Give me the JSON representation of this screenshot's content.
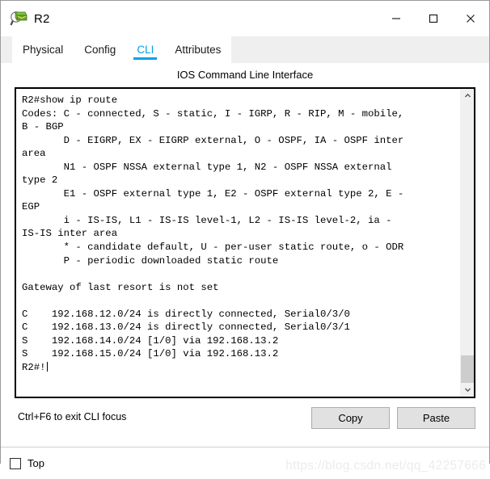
{
  "window": {
    "title": "R2",
    "icon": "router-device-icon",
    "controls": {
      "minimize": "minimize-icon",
      "maximize": "maximize-icon",
      "close": "close-icon"
    }
  },
  "tabs": [
    {
      "label": "Physical",
      "active": false
    },
    {
      "label": "Config",
      "active": false
    },
    {
      "label": "CLI",
      "active": true
    },
    {
      "label": "Attributes",
      "active": false
    }
  ],
  "cli": {
    "header": "IOS Command Line Interface",
    "terminal_text": "R2#show ip route\nCodes: C - connected, S - static, I - IGRP, R - RIP, M - mobile,\nB - BGP\n       D - EIGRP, EX - EIGRP external, O - OSPF, IA - OSPF inter\narea\n       N1 - OSPF NSSA external type 1, N2 - OSPF NSSA external\ntype 2\n       E1 - OSPF external type 1, E2 - OSPF external type 2, E -\nEGP\n       i - IS-IS, L1 - IS-IS level-1, L2 - IS-IS level-2, ia -\nIS-IS inter area\n       * - candidate default, U - per-user static route, o - ODR\n       P - periodic downloaded static route\n\nGateway of last resort is not set\n\nC    192.168.12.0/24 is directly connected, Serial0/3/0\nC    192.168.13.0/24 is directly connected, Serial0/3/1\nS    192.168.14.0/24 [1/0] via 192.168.13.2\nS    192.168.15.0/24 [1/0] via 192.168.13.2\n",
    "prompt": "R2#!",
    "scrollbar": {
      "up_arrow": "chevron-up-icon",
      "down_arrow": "chevron-down-icon"
    }
  },
  "bottom": {
    "hint": "Ctrl+F6 to exit CLI focus",
    "copy_label": "Copy",
    "paste_label": "Paste"
  },
  "footer": {
    "top_checkbox_label": "Top",
    "watermark": "https://blog.csdn.net/qq_42257666"
  },
  "colors": {
    "accent": "#00a2e8",
    "terminal_bg": "#ffffff",
    "terminal_fg": "#000000",
    "button_bg": "#e1e1e1"
  }
}
